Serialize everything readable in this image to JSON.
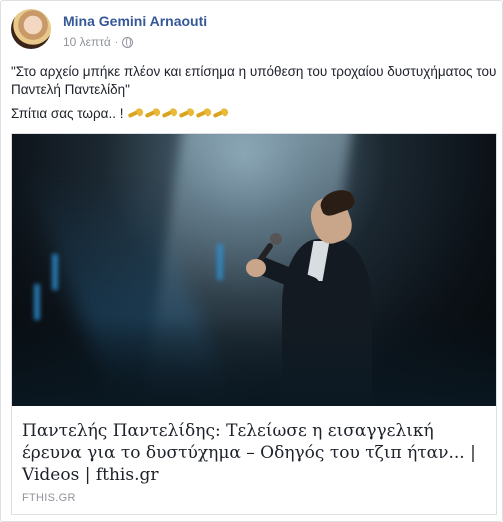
{
  "post": {
    "author": "Mina Gemini Arnaouti",
    "time": "10 λεπτά",
    "separator": "·",
    "privacy_icon": "globe-icon",
    "text_line1": "\"Στο αρχείο μπήκε πλέον και επίσημα η υπόθεση του τροχαίου δυστυχήματος του Παντελή Παντελίδη\"",
    "text_line2": "Σπίτια σας τωρα.. !",
    "emoji_icon": "trumpet-icon",
    "emoji_count": 6
  },
  "link": {
    "title": "Παντελής Παντελίδης: Τελείωσε η εισαγγελική έρευνα για το δυστύχημα – Οδηγός του τζιπ ήταν... | Videos | fthis.gr",
    "domain": "FTHIS.GR"
  },
  "colors": {
    "author": "#365899",
    "meta": "#90949c",
    "text": "#1d2129",
    "border": "#dddfe2"
  }
}
